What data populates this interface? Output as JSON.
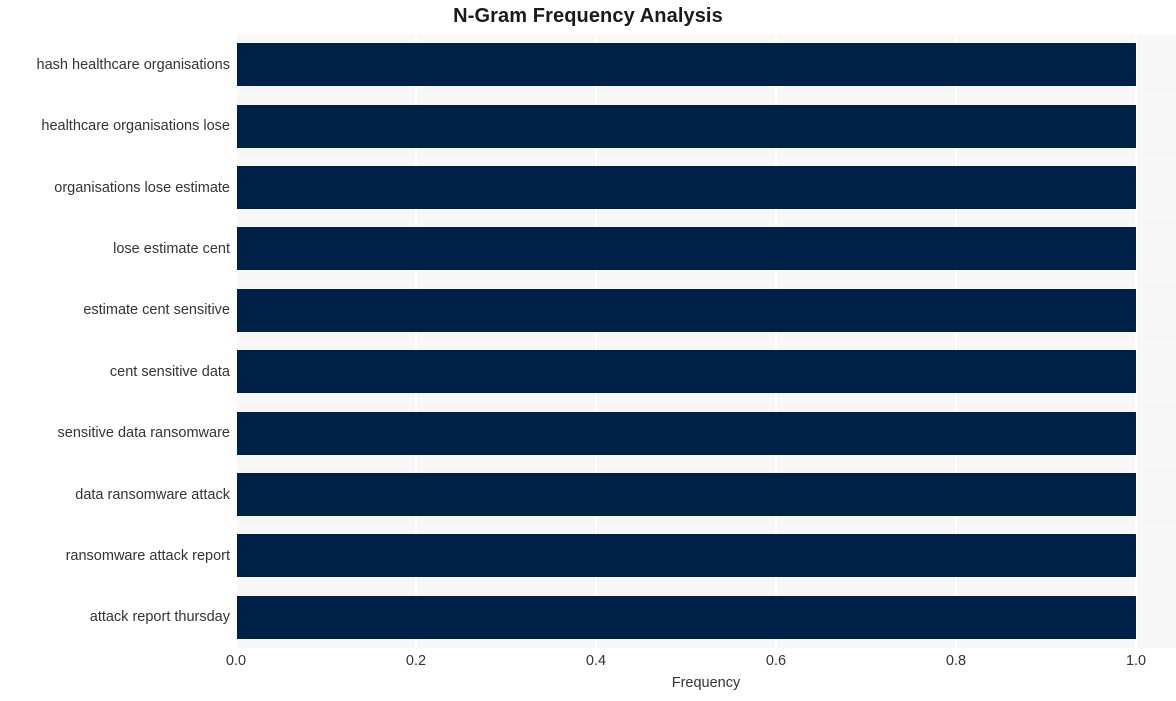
{
  "chart_data": {
    "type": "bar",
    "orientation": "horizontal",
    "title": "N-Gram Frequency Analysis",
    "xlabel": "Frequency",
    "ylabel": "",
    "categories": [
      "hash healthcare organisations",
      "healthcare organisations lose",
      "organisations lose estimate",
      "lose estimate cent",
      "estimate cent sensitive",
      "cent sensitive data",
      "sensitive data ransomware",
      "data ransomware attack",
      "ransomware attack report",
      "attack report thursday"
    ],
    "values": [
      1.0,
      1.0,
      1.0,
      1.0,
      1.0,
      1.0,
      1.0,
      1.0,
      1.0,
      1.0
    ],
    "xlim": [
      0.0,
      1.0444
    ],
    "xticks": [
      "0.0",
      "0.2",
      "0.4",
      "0.6",
      "0.8",
      "1.0"
    ],
    "xtick_values": [
      0.0,
      0.2,
      0.4,
      0.6,
      0.8,
      1.0
    ],
    "grid": true,
    "legend": false,
    "bar_color": "#002147",
    "plot_background": "#f7f7f7",
    "figure_background": "#ffffff",
    "gridline_color": "#ffffff",
    "text_color": "#333333",
    "title_color": "#1a1a1a"
  }
}
